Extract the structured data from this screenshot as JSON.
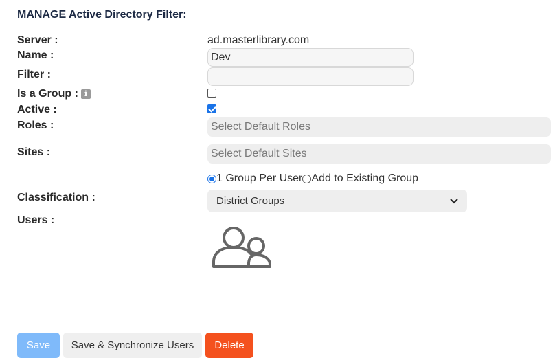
{
  "header": {
    "title": "MANAGE Active Directory Filter:"
  },
  "labels": {
    "server": "Server :",
    "name": "Name :",
    "filter": "Filter :",
    "is_group": "Is a Group :",
    "active": "Active :",
    "roles": "Roles :",
    "sites": "Sites :",
    "classification": "Classification :",
    "users": "Users :"
  },
  "fields": {
    "server_value": "ad.masterlibrary.com",
    "name_value": "Dev",
    "filter_value": "",
    "is_group_checked": false,
    "active_checked": true,
    "roles_placeholder": "Select Default Roles",
    "sites_placeholder": "Select Default Sites",
    "classification_selected": "District Groups"
  },
  "group_options": {
    "option1": "1 Group Per User",
    "option2": "Add to Existing Group",
    "selected": "option1"
  },
  "icons": {
    "info": "info-icon",
    "users": "users-group-icon",
    "dropdown": "chevron-down-icon"
  },
  "buttons": {
    "save": "Save",
    "save_sync": "Save & Synchronize Users",
    "delete": "Delete"
  },
  "colors": {
    "save_bg": "#7fbafa",
    "delete_bg": "#f4511e",
    "checkbox_accent": "#1a73e8"
  }
}
